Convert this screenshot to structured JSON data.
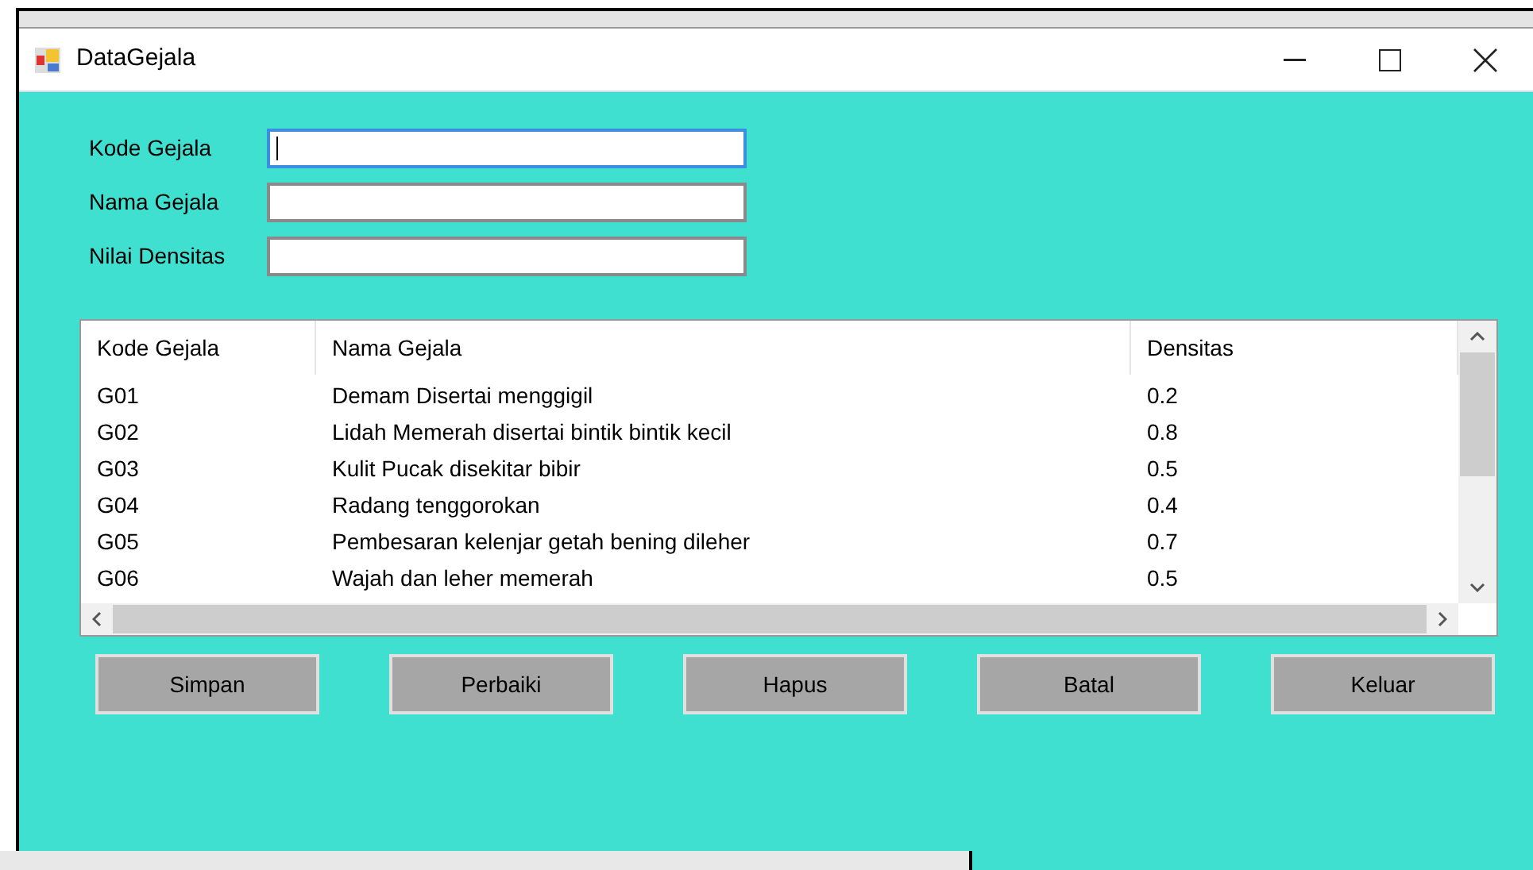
{
  "window": {
    "title": "DataGejala"
  },
  "fields": [
    {
      "label": "Kode Gejala",
      "focused": true
    },
    {
      "label": "Nama Gejala",
      "focused": false
    },
    {
      "label": "Nilai Densitas",
      "focused": false
    }
  ],
  "table": {
    "columns": [
      "Kode Gejala",
      "Nama Gejala",
      "Densitas"
    ],
    "rows": [
      [
        "G01",
        "Demam Disertai menggigil",
        "0.2"
      ],
      [
        "G02",
        "Lidah Memerah disertai bintik bintik kecil",
        "0.8"
      ],
      [
        "G03",
        "Kulit Pucak disekitar bibir",
        "0.5"
      ],
      [
        "G04",
        "Radang tenggorokan",
        "0.4"
      ],
      [
        "G05",
        "Pembesaran kelenjar getah bening dileher",
        "0.7"
      ],
      [
        "G06",
        "Wajah dan leher memerah",
        "0.5"
      ]
    ]
  },
  "buttons": [
    "Simpan",
    "Perbaiki",
    "Hapus",
    "Batal",
    "Keluar"
  ]
}
